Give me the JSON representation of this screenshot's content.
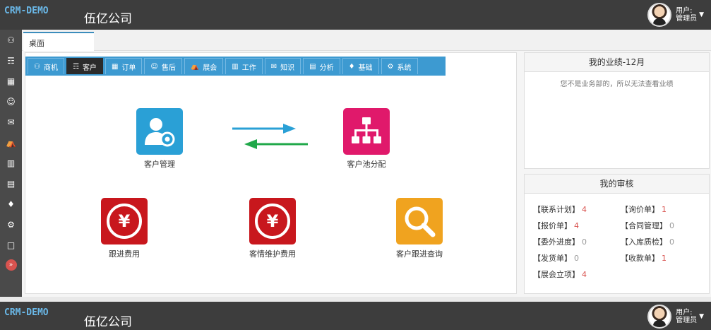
{
  "header": {
    "logo": "CRM-DEMO",
    "company": "伍亿公司",
    "user_label": "用户:",
    "user_role": "管理员"
  },
  "sidebar": {
    "icons": [
      "contact-icon",
      "users-icon",
      "table-icon",
      "smile-icon",
      "chat-icon",
      "bank-icon",
      "calendar-icon",
      "bar-chart-icon",
      "cubes-icon",
      "cogs-icon",
      "book-icon",
      "expand-icon"
    ]
  },
  "tabs": {
    "desk": "桌面"
  },
  "modules": [
    {
      "label": "商机",
      "icon": "contact-icon"
    },
    {
      "label": "客户",
      "icon": "users-icon"
    },
    {
      "label": "订单",
      "icon": "table-icon"
    },
    {
      "label": "售后",
      "icon": "smile-icon"
    },
    {
      "label": "展会",
      "icon": "bank-icon"
    },
    {
      "label": "工作",
      "icon": "calendar-icon"
    },
    {
      "label": "知识",
      "icon": "chat-icon"
    },
    {
      "label": "分析",
      "icon": "bar-chart-icon"
    },
    {
      "label": "基础",
      "icon": "cubes-icon"
    },
    {
      "label": "系统",
      "icon": "cogs-icon"
    }
  ],
  "active_module": "客户",
  "tiles": {
    "customer_mgmt": "客户管理",
    "pool_assign": "客户池分配",
    "followup_cost": "跟进费用",
    "relation_cost": "客情维护费用",
    "followup_query": "客户跟进查询"
  },
  "performance": {
    "title": "我的业绩-12月",
    "message": "您不是业务部的，所以无法查看业绩"
  },
  "audit": {
    "title": "我的审核",
    "items": [
      {
        "label": "【联系计划】",
        "count": "4"
      },
      {
        "label": "【询价单】",
        "count": "1"
      },
      {
        "label": "【报价单】",
        "count": "4"
      },
      {
        "label": "【合同管理】",
        "count": "0"
      },
      {
        "label": "【委外进度】",
        "count": "0"
      },
      {
        "label": "【入库质检】",
        "count": "0"
      },
      {
        "label": "【发货单】",
        "count": "0"
      },
      {
        "label": "【收款单】",
        "count": "1"
      },
      {
        "label": "【展会立项】",
        "count": "4"
      }
    ]
  },
  "colors": {
    "accent": "#3d9ad1",
    "topbar": "#3d3d3d",
    "count_red": "#d9534f"
  }
}
